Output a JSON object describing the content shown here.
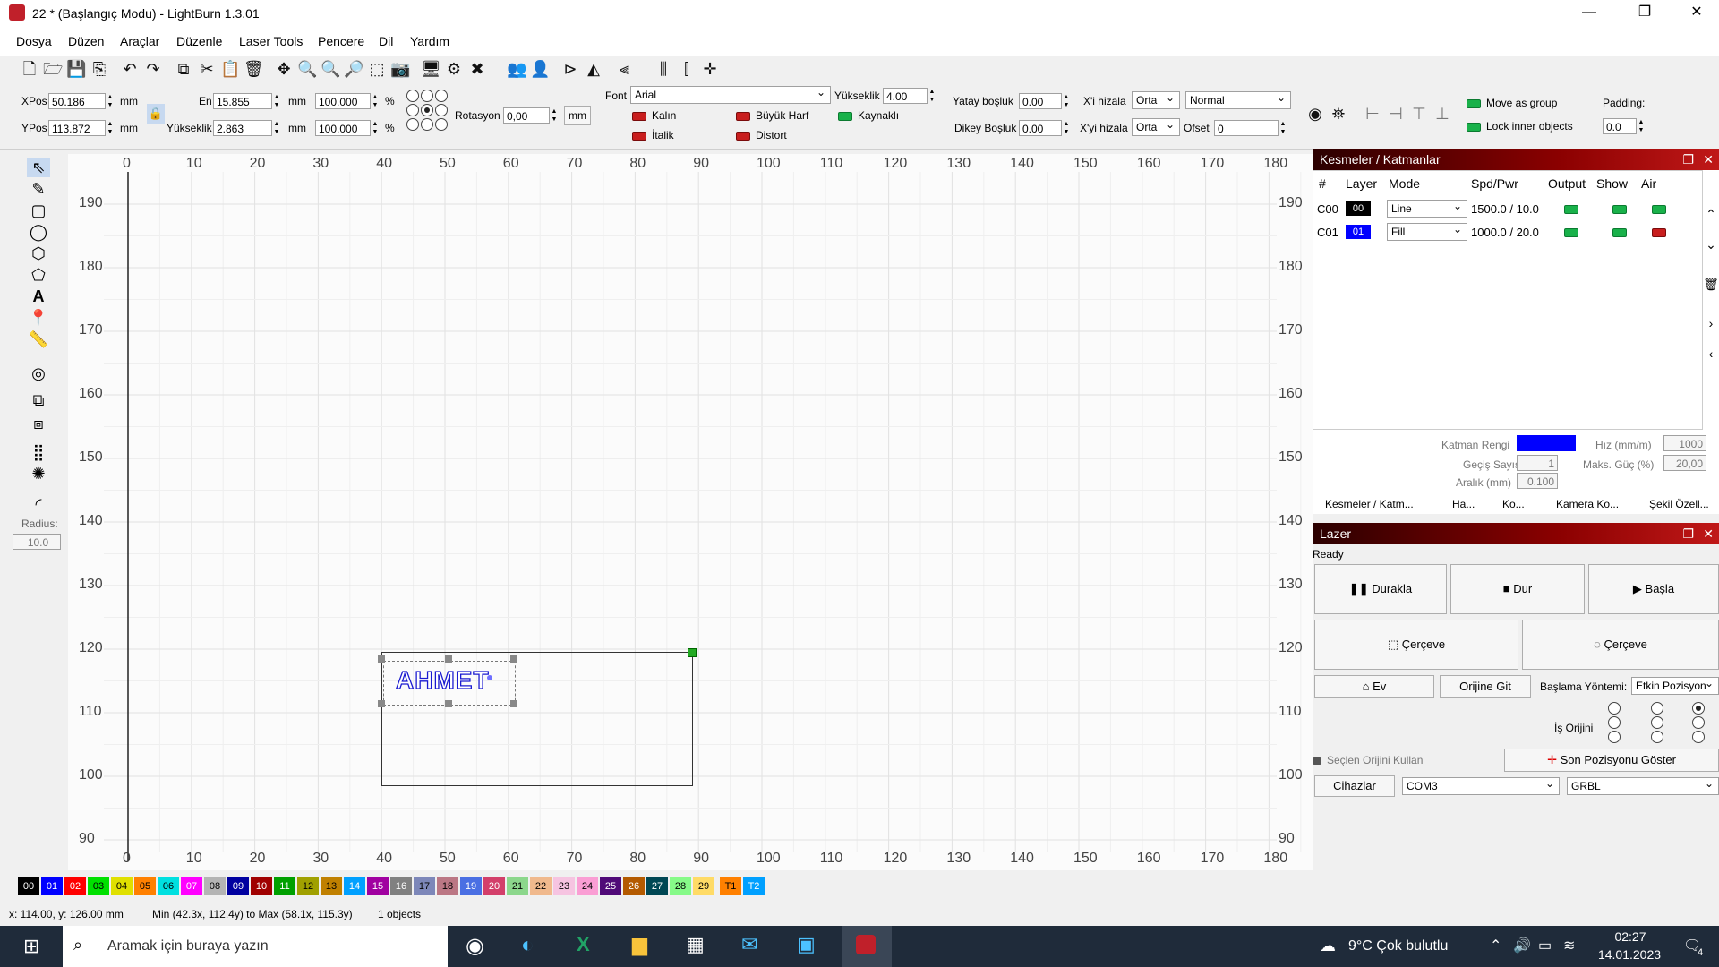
{
  "window": {
    "title": "22 * (Başlangıç Modu) - LightBurn 1.3.01",
    "minimize": "—",
    "restore": "❐",
    "close": "✕"
  },
  "menu": [
    "Dosya",
    "Düzen",
    "Araçlar",
    "Düzenle",
    "Laser Tools",
    "Pencere",
    "Dil",
    "Yardım"
  ],
  "props": {
    "xpos_label": "XPos",
    "xpos": "50.186",
    "ypos_label": "YPos",
    "ypos": "113.872",
    "unit": "mm",
    "en_label": "En",
    "en": "15.855",
    "yukseklik_label": "Yükseklik",
    "yukseklik": "2.863",
    "scale_w": "100.000",
    "scale_h": "100.000",
    "pct": "%",
    "rotasyon_label": "Rotasyon",
    "rotasyon": "0,00",
    "mm_btn": "mm",
    "font_label": "Font",
    "font": "Arial",
    "height_label": "Yükseklik",
    "height": "4.00",
    "kalin": "Kalın",
    "italik": "İtalik",
    "buyuk_harf": "Büyük Harf",
    "distort": "Distort",
    "kaynakli": "Kaynaklı",
    "yatay_label": "Yatay boşluk",
    "yatay": "0.00",
    "dikey_label": "Dikey Boşluk",
    "dikey": "0.00",
    "xhizala_label": "X'i hizala",
    "xhizala": "Orta",
    "yhizala_label": "X'yi hizala",
    "yhizala": "Orta",
    "mode": "Normal",
    "ofset_label": "Ofset",
    "ofset": "0",
    "move_group": "Move as group",
    "lock_inner": "Lock inner objects",
    "padding_label": "Padding:",
    "padding": "0.0"
  },
  "lefttools": {
    "radius_label": "Radius:",
    "radius": "10.0"
  },
  "canvas": {
    "top_ticks": [
      "0",
      "10",
      "20",
      "30",
      "40",
      "50",
      "60",
      "70",
      "80",
      "90",
      "100",
      "110",
      "120",
      "130",
      "140",
      "150",
      "160",
      "170",
      "180"
    ],
    "side_ticks": [
      "190",
      "180",
      "170",
      "160",
      "150",
      "140",
      "130",
      "120",
      "110",
      "100",
      "90"
    ],
    "text_object": "AHMET"
  },
  "cuts": {
    "title": "Kesmeler / Katmanlar",
    "columns": [
      "#",
      "Layer",
      "Mode",
      "Spd/Pwr",
      "Output",
      "Show",
      "Air"
    ],
    "rows": [
      {
        "id": "C00",
        "layer": "00",
        "mode": "Line",
        "spdpwr": "1500.0 / 10.0",
        "color": "#000000"
      },
      {
        "id": "C01",
        "layer": "01",
        "mode": "Fill",
        "spdpwr": "1000.0 / 20.0",
        "color": "#0000ff"
      }
    ],
    "katman_rengi": "Katman Rengi",
    "layer_color": "#0000ff",
    "hiz_label": "Hız (mm/m)",
    "hiz": "1000",
    "gecis_label": "Geçiş Sayısı",
    "gecis": "1",
    "maks_label": "Maks. Güç (%)",
    "maks": "20,00",
    "aralik_label": "Aralık (mm)",
    "aralik": "0.100",
    "tabs": [
      "Kesmeler / Katm...",
      "Ha...",
      "Ko...",
      "Kamera Ko...",
      "Şekil Özell..."
    ]
  },
  "laser": {
    "title": "Lazer",
    "status": "Ready",
    "durakla": "Durakla",
    "dur": "Dur",
    "basla": "Başla",
    "cerceve1": "Çerçeve",
    "cerceve2": "Çerçeve",
    "ev": "Ev",
    "orijine_git": "Orijine Git",
    "baslama_label": "Başlama Yöntemi:",
    "baslama": "Etkin Pozisyon",
    "is_orijini": "İş Orijini",
    "secilen_orijin": "Seçlen Orijini Kullan",
    "son_pozisyon": "Son Pozisyonu Göster",
    "cihazlar": "Cihazlar",
    "port": "COM3",
    "controller": "GRBL"
  },
  "palette": [
    {
      "n": "00",
      "c": "#000000",
      "t": "#ffffff"
    },
    {
      "n": "01",
      "c": "#0000ff",
      "t": "#ffffff"
    },
    {
      "n": "02",
      "c": "#ff0000",
      "t": "#ffffff"
    },
    {
      "n": "03",
      "c": "#00e000",
      "t": "#000000"
    },
    {
      "n": "04",
      "c": "#e0e000",
      "t": "#000000"
    },
    {
      "n": "05",
      "c": "#ff8000",
      "t": "#000000"
    },
    {
      "n": "06",
      "c": "#00e0e0",
      "t": "#000000"
    },
    {
      "n": "07",
      "c": "#ff00ff",
      "t": "#ffffff"
    },
    {
      "n": "08",
      "c": "#b4b4b4",
      "t": "#000000"
    },
    {
      "n": "09",
      "c": "#0000a0",
      "t": "#ffffff"
    },
    {
      "n": "10",
      "c": "#a00000",
      "t": "#ffffff"
    },
    {
      "n": "11",
      "c": "#00a000",
      "t": "#ffffff"
    },
    {
      "n": "12",
      "c": "#a0a000",
      "t": "#000000"
    },
    {
      "n": "13",
      "c": "#c08000",
      "t": "#000000"
    },
    {
      "n": "14",
      "c": "#00a0ff",
      "t": "#ffffff"
    },
    {
      "n": "15",
      "c": "#a000a0",
      "t": "#ffffff"
    },
    {
      "n": "16",
      "c": "#808080",
      "t": "#ffffff"
    },
    {
      "n": "17",
      "c": "#7d87b9",
      "t": "#000000"
    },
    {
      "n": "18",
      "c": "#bb7784",
      "t": "#000000"
    },
    {
      "n": "19",
      "c": "#4a6fe3",
      "t": "#ffffff"
    },
    {
      "n": "20",
      "c": "#d33f6a",
      "t": "#ffffff"
    },
    {
      "n": "21",
      "c": "#8cd78c",
      "t": "#000000"
    },
    {
      "n": "22",
      "c": "#f0b98d",
      "t": "#000000"
    },
    {
      "n": "23",
      "c": "#f6c4e1",
      "t": "#000000"
    },
    {
      "n": "24",
      "c": "#fa9ed4",
      "t": "#000000"
    },
    {
      "n": "25",
      "c": "#500a78",
      "t": "#ffffff"
    },
    {
      "n": "26",
      "c": "#b45a00",
      "t": "#ffffff"
    },
    {
      "n": "27",
      "c": "#004754",
      "t": "#ffffff"
    },
    {
      "n": "28",
      "c": "#86fa88",
      "t": "#000000"
    },
    {
      "n": "29",
      "c": "#ffdb66",
      "t": "#000000"
    },
    {
      "n": "T1",
      "c": "#ff8000",
      "t": "#000000"
    },
    {
      "n": "T2",
      "c": "#00a0ff",
      "t": "#ffffff"
    }
  ],
  "status": {
    "coords": "x: 114.00, y: 126.00 mm",
    "range": "Min (42.3x, 112.4y) to Max (58.1x, 115.3y)",
    "count": "1 objects"
  },
  "taskbar": {
    "search": "Aramak için buraya yazın",
    "weather": "9°C  Çok bulutlu",
    "time": "02:27",
    "date": "14.01.2023",
    "notif": "4"
  }
}
